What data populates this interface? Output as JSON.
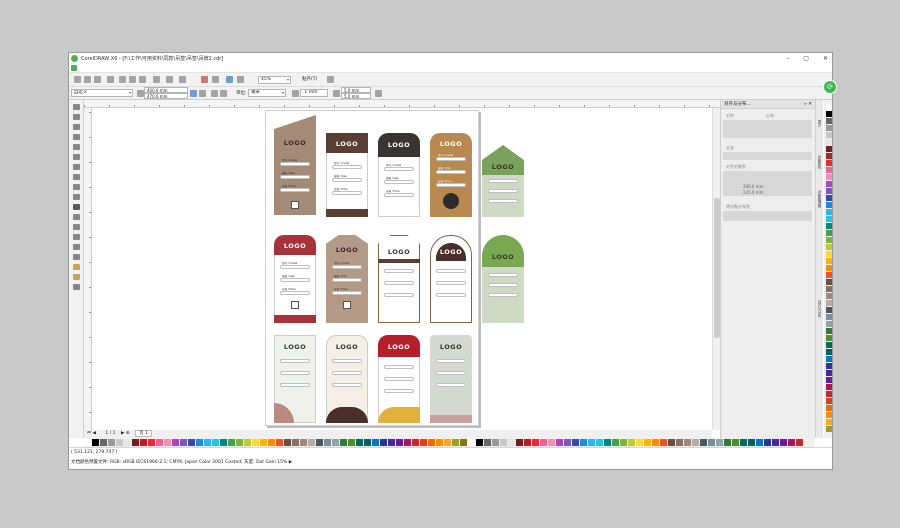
{
  "window": {
    "title": "CorelDRAW X6 - [F:\\工作\\可用资料\\同款\\吊签\\吊签\\吊牌2.cdr]",
    "controls": [
      "–",
      "▢",
      "✕"
    ]
  },
  "toolbar": {
    "zoom_value": "45%",
    "snap_label": "贴齐(T)",
    "preset_value": "自定义",
    "width_value": "400.0 mm",
    "height_value": "470.0 mm",
    "units_label": "单位:",
    "units_value": "毫米",
    "nudge_value": ".1 mm",
    "dup_x": "5.0 mm",
    "dup_y": "5.0 mm"
  },
  "docker": {
    "title": "对齐与分布...",
    "close": "»  ✕",
    "align_label": "对齐",
    "distribute_label": "分布",
    "text_label": "文本",
    "objects_label": "对齐对象到",
    "pos_x": "200.0 mm",
    "pos_y": "235.0 mm",
    "distribute_to_label": "将对象分布到",
    "tabs": [
      "提示",
      "对象属性",
      "对象管理器",
      "对齐与分布"
    ]
  },
  "tags": [
    {
      "logo": "LOGO",
      "bg": "#a48b78",
      "logo_color": "#3b2a22"
    },
    {
      "logo": "LOGO",
      "bg": "#5a3d33",
      "logo_color": "#ffffff"
    },
    {
      "logo": "LOGO",
      "bg": "#3a3333",
      "logo_color": "#ffffff"
    },
    {
      "logo": "LOGO",
      "bg": "#b98a4f",
      "logo_color": "#ffffff"
    },
    {
      "logo": "LOGO",
      "bg": "#7aa25a",
      "logo_color": "#2c3b22"
    },
    {
      "logo": "LOGO",
      "bg": "#a8323a",
      "logo_color": "#ffffff"
    },
    {
      "logo": "LOGO",
      "bg": "#b39a86",
      "logo_color": "#3a2a22"
    },
    {
      "logo": "LOGO",
      "bg": "#ffffff",
      "logo_color": "#3a2f2f"
    },
    {
      "logo": "LOGO",
      "bg": "#ffffff",
      "logo_color": "#3a2f2f"
    },
    {
      "logo": "LOGO",
      "bg": "#78a84f",
      "logo_color": "#2f3f24"
    },
    {
      "logo": "LOGO",
      "bg": "#eef1ec",
      "logo_color": "#333333"
    },
    {
      "logo": "LOGO",
      "bg": "#f4efe7",
      "logo_color": "#333333"
    },
    {
      "logo": "LOGO",
      "bg": "#b51f2b",
      "logo_color": "#ffffff"
    },
    {
      "logo": "LOGO",
      "bg": "#d5d9d2",
      "logo_color": "#333333"
    }
  ],
  "field_labels": [
    "型号 / model",
    "规格 / Size",
    "价格 / Price"
  ],
  "pagenav": {
    "counter": "1 / 1",
    "page_tab": "页 1"
  },
  "status": {
    "coords": "( 531.121, 279.747 )",
    "profile": "文档颜色预置文件: RGB: sRGB IEC61966-2.1; CMYK: Japan Color 2001 Coated; 灰度: Dot Gain 15% ▶"
  },
  "palette_colors": [
    "#ffffff",
    "#000000",
    "#666666",
    "#999999",
    "#c8c8c8",
    "#e6e6e6",
    "#7a1c1c",
    "#b22222",
    "#e03131",
    "#f06292",
    "#f48fb1",
    "#ab47bc",
    "#7e57c2",
    "#3949ab",
    "#1e88e5",
    "#29b6f6",
    "#26c6da",
    "#00897b",
    "#43a047",
    "#7cb342",
    "#c0ca33",
    "#fdd835",
    "#ffb300",
    "#fb8c00",
    "#f4511e",
    "#6d4c41",
    "#8d6e63",
    "#a1887f",
    "#bcaaa4",
    "#455a64",
    "#78909c",
    "#90a4ae",
    "#2e7d32",
    "#558b2f",
    "#00695c",
    "#006064",
    "#0277bd",
    "#283593",
    "#4527a0",
    "#6a1b9a",
    "#ad1457",
    "#c62828",
    "#d84315",
    "#ef6c00",
    "#ff8f00",
    "#f9a825",
    "#9e9d24",
    "#827717"
  ]
}
